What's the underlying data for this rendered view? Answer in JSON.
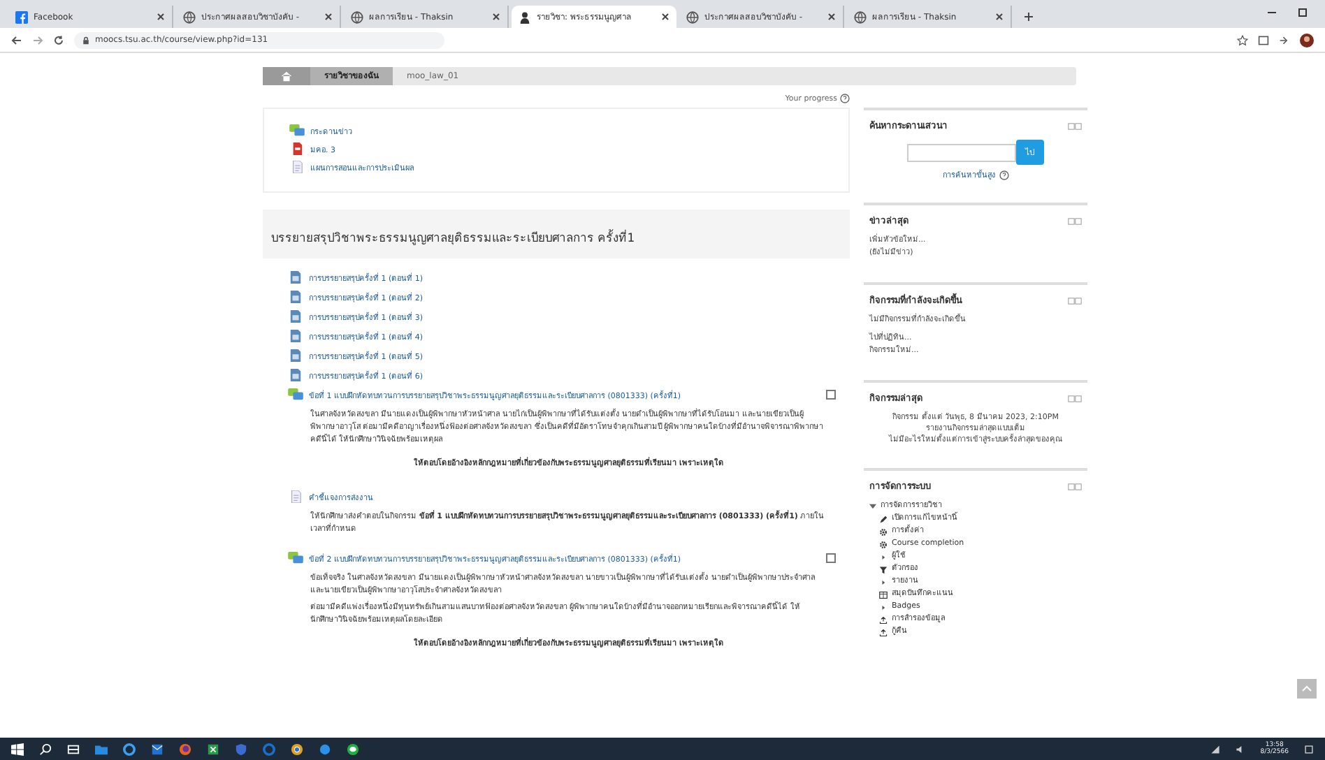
{
  "browser": {
    "tabs": [
      {
        "title": "Facebook",
        "kind": "facebook",
        "selected": false
      },
      {
        "title": "ประกาศผลสอบวิชาบังคับ -",
        "kind": "globe",
        "selected": false
      },
      {
        "title": "ผลการเรียน - Thaksin",
        "kind": "globe",
        "selected": false
      },
      {
        "title": "รายวิชา: พระธรรมนูญศาล",
        "kind": "moodle",
        "selected": true
      },
      {
        "title": "ประกาศผลสอบวิชาบังคับ -",
        "kind": "globe",
        "selected": false
      },
      {
        "title": "ผลการเรียน - Thaksin",
        "kind": "globe",
        "selected": false
      }
    ],
    "url": "moocs.tsu.ac.th/course/view.php?id=131"
  },
  "breadcrumb": [
    {
      "label": "รายวิชาของฉัน",
      "selected": true
    },
    {
      "label": "moo_law_01",
      "selected": false
    }
  ],
  "progress_label": "Your progress",
  "top_activities": [
    {
      "kind": "forum",
      "title": "กระดานข่าว"
    },
    {
      "kind": "pdf",
      "title": "มคอ. 3"
    },
    {
      "kind": "file",
      "title": "แผนการสอนและการประเมินผล"
    }
  ],
  "section": {
    "title": "บรรยายสรุปวิชาพระธรรมนูญศาลยุติธรรมและระเบียบศาลการ ครั้งที่1",
    "items": [
      {
        "kind": "video",
        "title": "การบรรยายสรุปครั้งที่ 1 (ตอนที่ 1)"
      },
      {
        "kind": "video",
        "title": "การบรรยายสรุปครั้งที่ 1 (ตอนที่ 2)"
      },
      {
        "kind": "video",
        "title": "การบรรยายสรุปครั้งที่ 1 (ตอนที่ 3)"
      },
      {
        "kind": "video",
        "title": "การบรรยายสรุปครั้งที่ 1 (ตอนที่ 4)"
      },
      {
        "kind": "video",
        "title": "การบรรยายสรุปครั้งที่ 1 (ตอนที่ 5)"
      },
      {
        "kind": "video",
        "title": "การบรรยายสรุปครั้งที่ 1 (ตอนที่ 6)"
      },
      {
        "kind": "forum",
        "title": "ข้อที่ 1 แบบฝึกหัดทบทวนการบรรยายสรุปวิชาพระธรรมนูญศาลยุติธรรมและระเบียบศาลการ (0801333) (ครั้งที่1)",
        "checked": false,
        "paragraphs": [
          "ในศาลจังหวัดสงขลา มีนายแดงเป็นผู้พิพากษาหัวหน้าศาล นายไก่เป็นผู้พิพากษาที่ได้รับแต่งตั้ง นายดำเป็นผู้พิพากษาที่ได้รับโอนมา และนายเขียวเป็นผู้พิพากษาอาวุโส ต่อมามีคดีอาญาเรื่องหนึ่งฟ้องต่อศาลจังหวัดสงขลา ซึ่งเป็นคดีที่มีอัตราโทษจำคุกเกินสามปี ผู้พิพากษาคนใดบ้างที่มีอำนาจพิจารณาพิพากษาคดีนี้ได้ ให้นักศึกษาวินิจฉัยพร้อมเหตุผล"
        ],
        "note": "ให้ตอบโดยอ้างอิงหลักกฎหมายที่เกี่ยวข้องกับพระธรรมนูญศาลยุติธรรมที่เรียนมา เพราะเหตุใด"
      },
      {
        "kind": "file",
        "title": "คำชี้แจงการส่งงาน",
        "paragraphs": [
          "ให้นักศึกษาส่งคำตอบในกิจกรรม **ข้อที่ 1 แบบฝึกหัดทบทวนการบรรยายสรุปวิชาพระธรรมนูญศาลยุติธรรมและระเบียบศาลการ (0801333) (ครั้งที่1)** ภายในเวลาที่กำหนด"
        ]
      },
      {
        "kind": "forum",
        "title": "ข้อที่ 2 แบบฝึกหัดทบทวนการบรรยายสรุปวิชาพระธรรมนูญศาลยุติธรรมและระเบียบศาลการ (0801333) (ครั้งที่1)",
        "checked": false,
        "paragraphs": [
          "ข้อเท็จจริง ในศาลจังหวัดสงขลา มีนายแดงเป็นผู้พิพากษาหัวหน้าศาลจังหวัดสงขลา นายขาวเป็นผู้พิพากษาที่ได้รับแต่งตั้ง นายดำเป็นผู้พิพากษาประจำศาล และนายเขียวเป็นผู้พิพากษาอาวุโสประจำศาลจังหวัดสงขลา",
          "ต่อมามีคดีแพ่งเรื่องหนึ่งมีทุนทรัพย์เกินสามแสนบาทฟ้องต่อศาลจังหวัดสงขลา ผู้พิพากษาคนใดบ้างที่มีอำนาจออกหมายเรียกและพิจารณาคดีนี้ได้ ให้นักศึกษาวินิจฉัยพร้อมเหตุผลโดยละเอียด"
        ],
        "note": "ให้ตอบโดยอ้างอิงหลักกฎหมายที่เกี่ยวข้องกับพระธรรมนูญศาลยุติธรรมที่เรียนมา เพราะเหตุใด"
      }
    ]
  },
  "blocks": [
    {
      "kind": "search",
      "title": "ค้นหากระดานเสวนา",
      "button": "ไป",
      "link": "การค้นหาขั้นสูง"
    },
    {
      "kind": "news",
      "title": "ข่าวล่าสุด",
      "lines": [
        "เพิ่มหัวข้อใหม่...",
        "(ยังไม่มีข่าว)"
      ]
    },
    {
      "kind": "upcoming",
      "title": "กิจกรรมที่กำลังจะเกิดขึ้น",
      "lines": [
        "ไม่มีกิจกรรมที่กำลังจะเกิดขึ้น",
        "ไปที่ปฏิทิน...",
        "กิจกรรมใหม่..."
      ]
    },
    {
      "kind": "recent",
      "title": "กิจกรรมล่าสุด",
      "lines": [
        "กิจกรรม ตั้งแต่ วันพุธ, 8 มีนาคม 2023, 2:10PM",
        "รายงานกิจกรรมล่าสุดแบบเต็ม",
        "ไม่มีอะไรใหม่ตั้งแต่การเข้าสู่ระบบครั้งล่าสุดของคุณ"
      ]
    },
    {
      "kind": "admin",
      "title": "การจัดการระบบ",
      "tree": [
        {
          "label": "การจัดการรายวิชา",
          "expanded": true,
          "children": [
            {
              "kind": "pencil",
              "label": "เปิดการแก้ไขหน้านี้"
            },
            {
              "kind": "gear",
              "label": "การตั้งค่า"
            },
            {
              "kind": "gear",
              "label": "Course completion"
            },
            {
              "kind": "arrow",
              "label": "ผู้ใช้"
            },
            {
              "kind": "funnel",
              "label": "ตัวกรอง"
            },
            {
              "kind": "arrow",
              "label": "รายงาน"
            },
            {
              "kind": "table",
              "label": "สมุดบันทึกคะแนน"
            },
            {
              "kind": "arrow",
              "label": "Badges"
            },
            {
              "kind": "upload",
              "label": "การสำรองข้อมูล"
            },
            {
              "kind": "upload",
              "label": "กู้คืน"
            }
          ]
        }
      ]
    }
  ],
  "taskbar": {
    "time": "13:58",
    "date": "8/3/2566"
  }
}
